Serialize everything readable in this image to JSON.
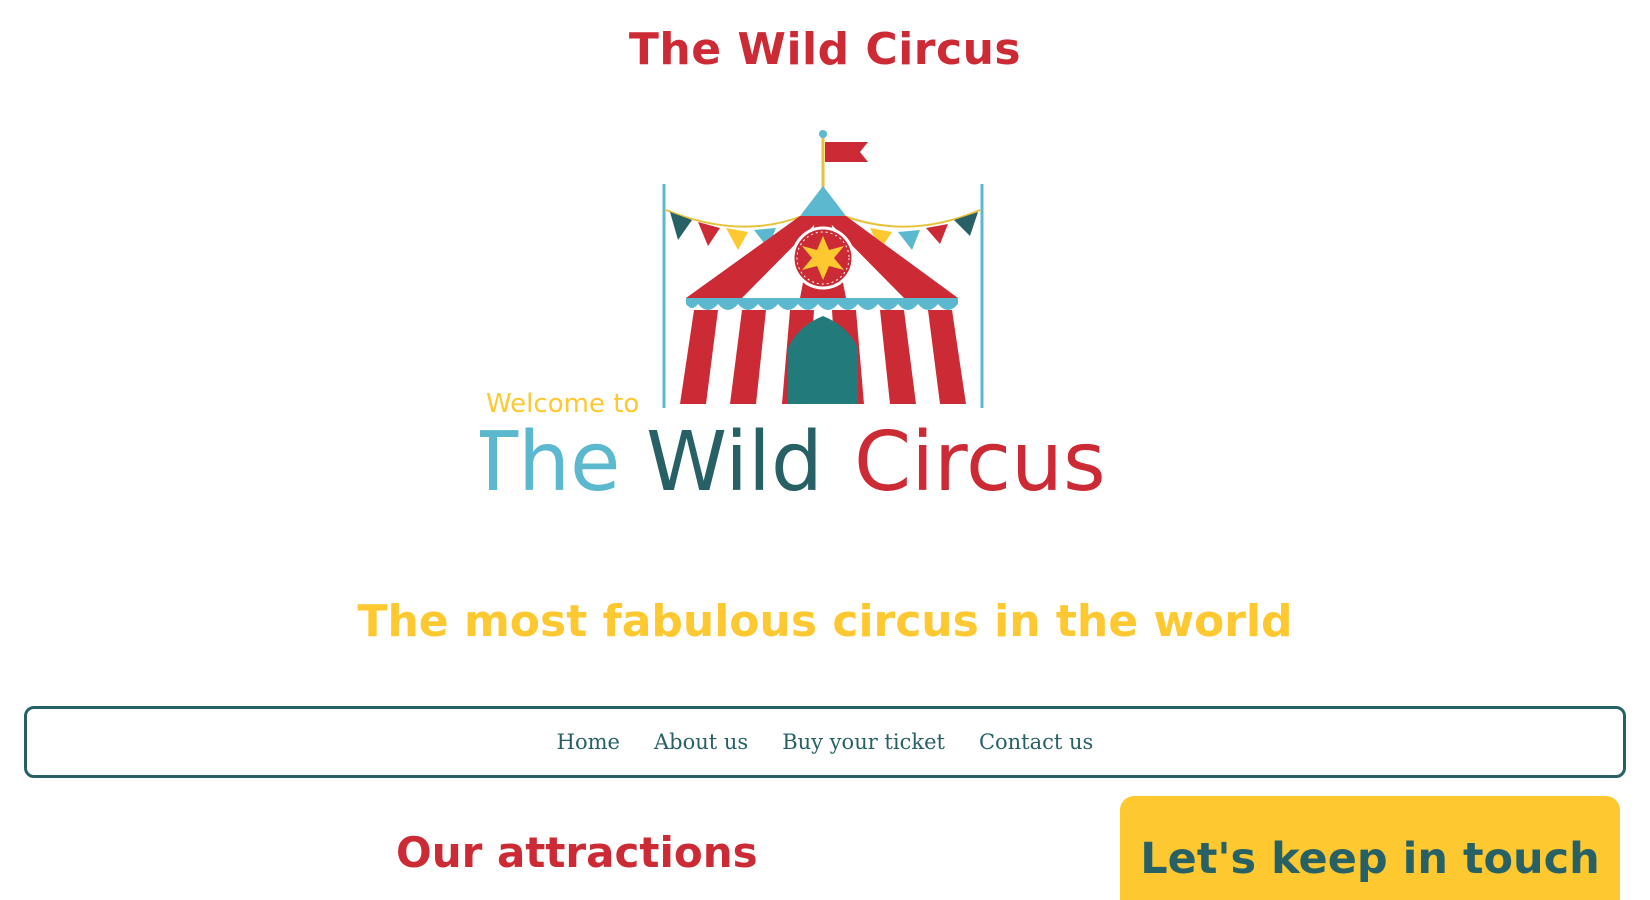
{
  "header": {
    "site_title": "The Wild Circus",
    "tagline": "The most fabulous circus in the world"
  },
  "logo": {
    "icon": "circus-tent-icon",
    "welcome_text": "Welcome to",
    "name_part1": "The",
    "name_part2": "Wild",
    "name_part3": "Circus"
  },
  "nav": {
    "items": [
      {
        "label": "Home"
      },
      {
        "label": "About us"
      },
      {
        "label": "Buy your ticket"
      },
      {
        "label": "Contact us"
      }
    ]
  },
  "main": {
    "section_title": "Our attractions"
  },
  "contact": {
    "title": "Let's keep in touch"
  },
  "colors": {
    "red": "#cc2b36",
    "yellow": "#fdc830",
    "teal": "#276166",
    "light_blue": "#5bb8cf"
  }
}
